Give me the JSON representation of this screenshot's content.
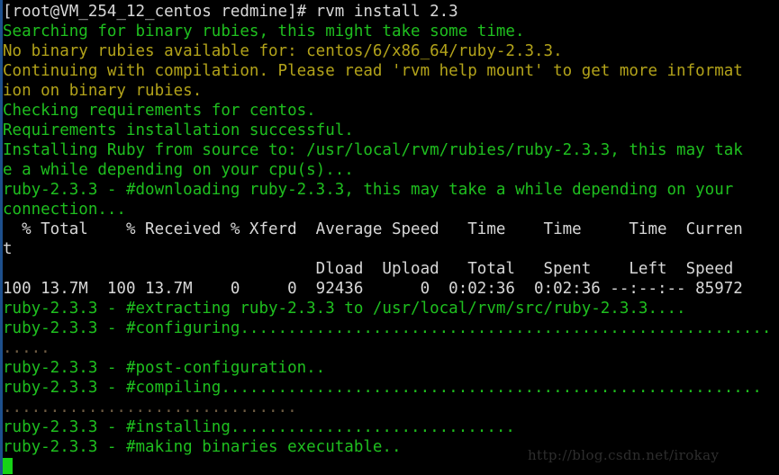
{
  "terminal": {
    "app": "terminal-console",
    "background_color": "#000000",
    "left_edge_color": "#1d4f8c",
    "colors": {
      "white": "#d8d8d8",
      "green": "#1fbf1f",
      "yellow": "#b3a31a",
      "dim": "#6e5b42",
      "cursor": "#16d316",
      "watermark": "#2e2e2e"
    },
    "prompt": "[root@VM_254_12_centos redmine]# ",
    "command": "rvm install 2.3",
    "cursor_visible": true,
    "lines": [
      {
        "color": "white",
        "text": "[root@VM_254_12_centos redmine]# rvm install 2.3"
      },
      {
        "color": "green",
        "text": "Searching for binary rubies, this might take some time."
      },
      {
        "color": "yellow",
        "text": "No binary rubies available for: centos/6/x86_64/ruby-2.3.3."
      },
      {
        "color": "yellow",
        "text": "Continuing with compilation. Please read 'rvm help mount' to get more informat"
      },
      {
        "color": "yellow",
        "text": "ion on binary rubies."
      },
      {
        "color": "green",
        "text": "Checking requirements for centos."
      },
      {
        "color": "green",
        "text": "Requirements installation successful."
      },
      {
        "color": "green",
        "text": "Installing Ruby from source to: /usr/local/rvm/rubies/ruby-2.3.3, this may tak"
      },
      {
        "color": "green",
        "text": "e a while depending on your cpu(s)..."
      },
      {
        "color": "green",
        "text": "ruby-2.3.3 - #downloading ruby-2.3.3, this may take a while depending on your"
      },
      {
        "color": "green",
        "text": "connection..."
      },
      {
        "color": "white",
        "text": "  % Total    % Received % Xferd  Average Speed   Time    Time     Time  Curren"
      },
      {
        "color": "white",
        "text": "t"
      },
      {
        "color": "white",
        "text": "                                 Dload  Upload   Total   Spent    Left  Speed"
      },
      {
        "color": "white",
        "text": "100 13.7M  100 13.7M    0     0  92436      0  0:02:36  0:02:36 --:--:-- 85972"
      },
      {
        "color": "green",
        "text": "ruby-2.3.3 - #extracting ruby-2.3.3 to /usr/local/rvm/src/ruby-2.3.3...."
      },
      {
        "color": "green",
        "text": "ruby-2.3.3 - #configuring........................................................"
      },
      {
        "color": "dim",
        "text": "....."
      },
      {
        "color": "green",
        "text": "ruby-2.3.3 - #post-configuration.."
      },
      {
        "color": "green",
        "text": "ruby-2.3.3 - #compiling........................................................."
      },
      {
        "color": "dim",
        "text": "..............................."
      },
      {
        "color": "green",
        "text": "ruby-2.3.3 - #installing.............................."
      },
      {
        "color": "green",
        "text": "ruby-2.3.3 - #making binaries executable.."
      }
    ],
    "watermark": "http://blog.csdn.net/irokay"
  }
}
